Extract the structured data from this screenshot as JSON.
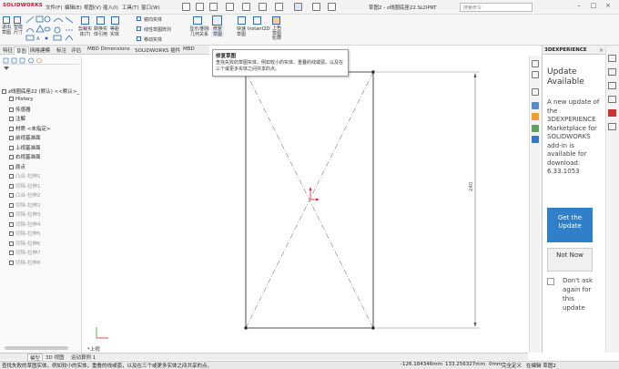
{
  "app": {
    "logo": "SOLIDWORKS",
    "document_title": "草图2 - z线圈底座22.SLDPRT",
    "search_placeholder": "搜索命令"
  },
  "menu": [
    "文件(F)",
    "编辑(E)",
    "视图(V)",
    "插入(I)",
    "工具(T)",
    "窗口(W)"
  ],
  "ribbon": {
    "left_buttons": [
      {
        "label": "退出\n草图"
      },
      {
        "label": "智能\n尺寸"
      }
    ],
    "mid_buttons": [
      {
        "label": "剪裁实\n体(T)"
      },
      {
        "label": "转换实\n体引用"
      },
      {
        "label": "等距\n实体"
      }
    ],
    "small_tools": [
      "镜向实体",
      "线性草图阵列",
      "移动实体"
    ],
    "right_buttons": [
      {
        "label": "显示/删除\n几何关系"
      },
      {
        "label": "修复\n草图"
      },
      {
        "label": "快速\n草图"
      },
      {
        "label": "Instant2D"
      },
      {
        "label": "上色\n草图\n轮廓"
      }
    ]
  },
  "ribbon_tabs": [
    "特征",
    "草图",
    "网格建模",
    "标注",
    "评估",
    "MBD Dimensions",
    "SOLIDWORKS 插件",
    "MBD"
  ],
  "active_ribbon_tab": "草图",
  "tooltip": {
    "title": "修复草图",
    "body": "查找失败的草图实体，例如较小的实体、重叠的线或弧，以及在三个或更多实体之间共享的点。"
  },
  "tree": [
    {
      "label": "z线圈底座22 (默认) <<默认>_",
      "dim": false
    },
    {
      "label": "History",
      "dim": false
    },
    {
      "label": "传感器",
      "dim": false
    },
    {
      "label": "注解",
      "dim": false
    },
    {
      "label": "材质 <未指定>",
      "dim": false
    },
    {
      "label": "前视基准面",
      "dim": false
    },
    {
      "label": "上视基准面",
      "dim": false
    },
    {
      "label": "右视基准面",
      "dim": false
    },
    {
      "label": "原点",
      "dim": false
    },
    {
      "label": "凸台-拉伸1",
      "dim": true
    },
    {
      "label": "切除-拉伸1",
      "dim": true
    },
    {
      "label": "凸台-拉伸2",
      "dim": true
    },
    {
      "label": "切除-拉伸2",
      "dim": true
    },
    {
      "label": "切除-拉伸3",
      "dim": true
    },
    {
      "label": "切除-拉伸4",
      "dim": true
    },
    {
      "label": "切除-拉伸5",
      "dim": true
    },
    {
      "label": "切除-拉伸6",
      "dim": true
    },
    {
      "label": "切除-拉伸7",
      "dim": true
    },
    {
      "label": "切除-拉伸8",
      "dim": true
    }
  ],
  "canvas": {
    "dimension_label": "240",
    "view_label": "*上视"
  },
  "experience_panel": {
    "header": "3DEXPERIENCE",
    "title": "Update Available",
    "message": "A new update of the 3DEXPERIENCE Marketplace for SOLIDWORKS add-in is available for download: 6.33.1053",
    "get_update": "Get the Update",
    "not_now": "Not Now",
    "dont_ask": "Don't ask again for this update"
  },
  "bottom_tabs": [
    "模型",
    "3D 视图",
    "运动算例 1"
  ],
  "active_bottom_tab": "模型",
  "status": {
    "hint": "查找失败的草图实体，例如较小的实体，重叠的线或弧，以及在三个或更多实体之间共享的点。",
    "x": "-126.184346mm",
    "y": "133.256327mm",
    "z": "0mm",
    "state": "完全定义",
    "editing": "在编辑 草图2"
  },
  "colors": {
    "accent": "#2f80c8",
    "logo_red": "#c8102e"
  }
}
